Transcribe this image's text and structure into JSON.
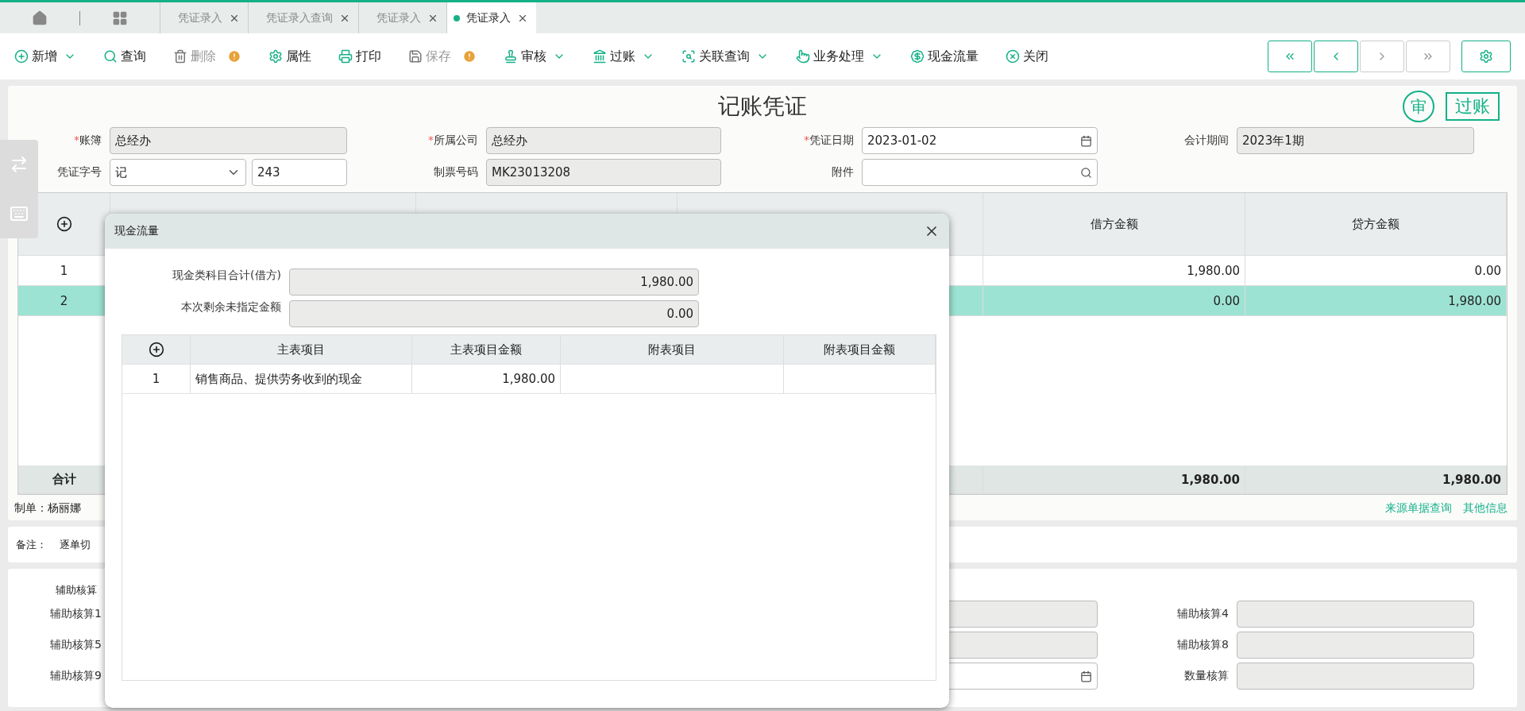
{
  "tabs": [
    {
      "label": "凭证录入",
      "selected": false
    },
    {
      "label": "凭证录入查询",
      "selected": false
    },
    {
      "label": "凭证录入",
      "selected": false
    },
    {
      "label": "凭证录入",
      "selected": true
    }
  ],
  "toolbar": [
    {
      "label": "新增",
      "disabled": false,
      "warning": false,
      "dropdown": true
    },
    {
      "label": "查询",
      "disabled": false,
      "warning": false,
      "dropdown": false
    },
    {
      "label": "删除",
      "disabled": true,
      "warning": true,
      "dropdown": false
    },
    {
      "label": "属性",
      "disabled": false,
      "warning": false,
      "dropdown": false
    },
    {
      "label": "打印",
      "disabled": false,
      "warning": false,
      "dropdown": false
    },
    {
      "label": "保存",
      "disabled": true,
      "warning": true,
      "dropdown": false
    },
    {
      "label": "审核",
      "disabled": false,
      "warning": false,
      "dropdown": true
    },
    {
      "label": "过账",
      "disabled": false,
      "warning": false,
      "dropdown": true
    },
    {
      "label": "关联查询",
      "disabled": false,
      "warning": false,
      "dropdown": true
    },
    {
      "label": "业务处理",
      "disabled": false,
      "warning": false,
      "dropdown": true
    },
    {
      "label": "现金流量",
      "disabled": false,
      "warning": false,
      "dropdown": false
    },
    {
      "label": "关闭",
      "disabled": false,
      "warning": false,
      "dropdown": false
    }
  ],
  "nav_buttons": [
    {
      "disabled": false
    },
    {
      "disabled": false
    },
    {
      "disabled": true
    },
    {
      "disabled": true
    }
  ],
  "voucher": {
    "title": "记账凭证",
    "audit_stamp": "审",
    "status_stamp": "过账",
    "fields": [
      {
        "label": "账簿",
        "required_mark": "*",
        "kind": "readonly",
        "value": "总经办"
      },
      {
        "label": "所属公司",
        "required_mark": "*",
        "kind": "readonly",
        "value": "总经办"
      },
      {
        "label": "凭证日期",
        "required_mark": "*",
        "kind": "date",
        "value": "2023-01-02"
      },
      {
        "label": "会计期间",
        "kind": "readonly",
        "value": "2023年1期"
      },
      {
        "label": "凭证字号",
        "kind": "select_pair",
        "value": "记",
        "value_2": "243"
      },
      {
        "label": "制票号码",
        "kind": "readonly",
        "value": "MK23013208"
      },
      {
        "label": "附件",
        "kind": "search"
      }
    ]
  },
  "entries": {
    "columns": [
      "借方金额",
      "贷方金额"
    ],
    "rows": [
      {
        "no": "1",
        "debit": "1,980.00",
        "credit": "0.00",
        "selected": false
      },
      {
        "no": "2",
        "debit": "0.00",
        "credit": "1,980.00",
        "selected": true
      }
    ],
    "total": {
      "label": "合计",
      "debit": "1,980.00",
      "credit": "1,980.00"
    }
  },
  "footer": {
    "maker": "制单：杨丽娜",
    "links": [
      "来源单据查询",
      "其他信息"
    ]
  },
  "remark": {
    "label": "备注：",
    "value": "逐单切"
  },
  "auxiliary": {
    "heading": "辅助核算",
    "rows": [
      {
        "label": "辅助核算1",
        "middle_date": false,
        "right_label": "辅助核算4"
      },
      {
        "label": "辅助核算5",
        "middle_date": false,
        "right_label": "辅助核算8"
      },
      {
        "label": "辅助核算9",
        "middle_date": true,
        "right_label": "数量核算"
      }
    ]
  },
  "dialog": {
    "title": "现金流量",
    "summary": [
      {
        "label": "现金类科目合计(借方)",
        "value": "1,980.00"
      },
      {
        "label": "本次剩余未指定金额",
        "value": "0.00"
      }
    ],
    "columns": [
      "主表项目",
      "主表项目金额",
      "附表项目",
      "附表项目金额"
    ],
    "rows": [
      {
        "no": "1",
        "cells": [
          "销售商品、提供劳务收到的现金",
          "1,980.00",
          "",
          ""
        ]
      }
    ]
  }
}
